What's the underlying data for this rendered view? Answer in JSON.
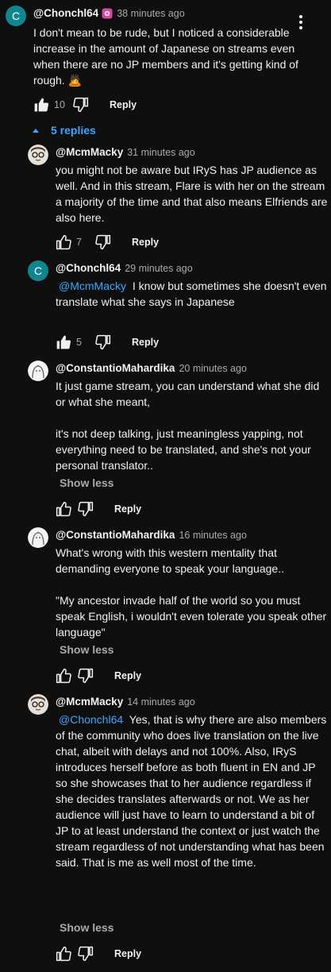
{
  "main_comment": {
    "avatar_letter": "C",
    "author": "@Chonchl64",
    "time": "38 minutes ago",
    "text": "I don't mean to be rude, but I noticed a considerable increase in the amount of Japanese on streams even when there are no JP members and it's getting kind of rough. 🙇",
    "likes": "10",
    "reply_label": "Reply"
  },
  "replies_toggle": {
    "label": "5 replies"
  },
  "replies": [
    {
      "author": "@McmMacky",
      "time": "31 minutes ago",
      "mention": "",
      "text": "you might not be aware but IRyS has JP audience as well. And in this stream, Flare is with her on the stream a majority of the time and that also means Elfriends are also here.",
      "likes": "7",
      "reply_label": "Reply",
      "show_less": ""
    },
    {
      "avatar_letter": "C",
      "author": "@Chonchl64",
      "time": "29 minutes ago",
      "mention": "@McmMacky",
      "text": "I know but sometimes she doesn't even translate what she says in Japanese",
      "likes": "5",
      "reply_label": "Reply",
      "show_less": ""
    },
    {
      "author": "@ConstantioMahardika",
      "time": "20 minutes ago",
      "mention": "",
      "text": "It just game stream, you can understand what she did or what she meant,\n\nit's not deep talking, just meaningless yapping, not everything need to be translated, and she's not your personal translator..",
      "likes": "",
      "reply_label": "Reply",
      "show_less": "Show less"
    },
    {
      "author": "@ConstantioMahardika",
      "time": "16 minutes ago",
      "mention": "",
      "text": "What's wrong with this western mentality that demanding everyone to speak your language..\n\n\"My ancestor invade half of the world so you must speak English, i wouldn't even tolerate you speak other language\"",
      "likes": "",
      "reply_label": "Reply",
      "show_less": "Show less"
    },
    {
      "author": "@McmMacky",
      "time": "14 minutes ago",
      "mention": "@Chonchl64",
      "text": "Yes, that is why there are also members of the community who does live translation on the live chat, albeit with delays and not 100%. Also, IRyS introduces herself before as both fluent in EN and JP so she showcases that to her audience regardless if she decides translates afterwards or not. We as her audience will just have to learn to understand a bit of JP to at least understand the context or just watch the stream regardless of not understanding what has been said. That is me as well most of the time.",
      "likes": "",
      "reply_label": "Reply",
      "show_less": "Show less"
    }
  ],
  "icons": {
    "like": "thumbs-up-icon",
    "dislike": "thumbs-down-icon",
    "menu": "more-vert-icon",
    "toggle": "caret-up-icon",
    "badge": "member-badge-icon"
  },
  "colors": {
    "background": "#0f0f0f",
    "link": "#3ea6ff",
    "avatar_c": "#12858f",
    "muted": "#aaaaaa"
  }
}
